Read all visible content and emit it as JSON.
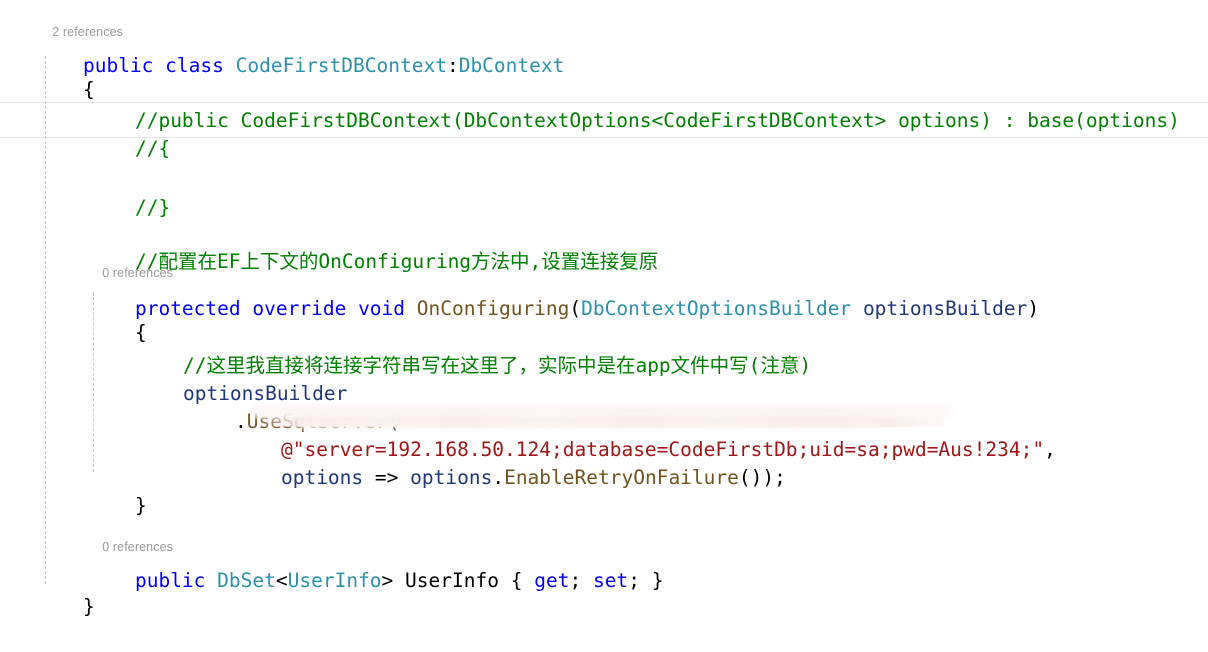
{
  "editor": {
    "language": "csharp",
    "theme": "visual-studio-light",
    "background_color": "#ffffff",
    "font_size_px": 19.5,
    "line_height_px": 30,
    "colors": {
      "keyword": "#0000ff",
      "type": "#2b91af",
      "comment": "#008000",
      "string": "#a31515",
      "method": "#74531f",
      "parameter": "#1f377f",
      "plain_text": "#000000",
      "codelens": "#9a9a9a",
      "indent_guide": "#c8c8c8",
      "current_line_border": "#e6e6f0",
      "redaction_overlay": "#f7e8e8"
    }
  },
  "clipped_top_line": {
    "text": "//......",
    "note": "partially cut off comment line at very top of viewport"
  },
  "codelens": [
    {
      "id": "class-refs",
      "text": "2 references",
      "count": "2",
      "label": "references"
    },
    {
      "id": "method-refs",
      "text": "0 references",
      "count": "0",
      "label": "references"
    },
    {
      "id": "property-refs",
      "text": "0 references",
      "count": "0",
      "label": "references"
    }
  ],
  "code": {
    "class_declaration": {
      "keyword_public": "public",
      "keyword_class": "class",
      "class_name": "CodeFirstDBContext",
      "colon": ":",
      "base_type": "DbContext"
    },
    "open_brace_class": "{",
    "close_brace_class": "}",
    "commented_ctor": {
      "line1": "//public CodeFirstDBContext(DbContextOptions<CodeFirstDBContext> options) : base(options)",
      "line2": "//{",
      "line3": "//}"
    },
    "comment_onconfiguring": "//配置在EF上下文的OnConfiguring方法中,设置连接复原",
    "method_signature": {
      "keyword_protected": "protected",
      "keyword_override": "override",
      "keyword_void": "void",
      "method_name": "OnConfiguring",
      "paren_open": "(",
      "param_type": "DbContextOptionsBuilder",
      "param_name": "optionsBuilder",
      "paren_close": ")"
    },
    "open_brace_method": "{",
    "close_brace_method": "}",
    "comment_connstring": "//这里我直接将连接字符串写在这里了，实际中是在app文件中写(注意)",
    "options_builder_ident": "optionsBuilder",
    "use_sql_server": {
      "dot": ".",
      "method_name": "UseSqlServer",
      "paren_open": "("
    },
    "connection_string": {
      "at_sign": "@",
      "quote_open": "\"",
      "redacted": true,
      "visible_tail": "d=Aus!234;",
      "quote_close": "\"",
      "comma": ",",
      "full_text_hidden": "server=192.168.50.124;database=CodeFirstDb;uid=sa;pwd=Aus!234;"
    },
    "retry_lambda": {
      "param": "options",
      "arrow": "=>",
      "target": "options",
      "dot": ".",
      "method_name": "EnableRetryOnFailure",
      "tail": "());"
    },
    "dbset_property": {
      "keyword_public": "public",
      "generic_type": "DbSet",
      "angle_open": "<",
      "type_arg": "UserInfo",
      "angle_close": ">",
      "property_name": "UserInfo",
      "brace_open": "{",
      "keyword_get": "get",
      "semicolon1": ";",
      "keyword_set": "set",
      "semicolon2": ";",
      "brace_close": "}"
    }
  }
}
